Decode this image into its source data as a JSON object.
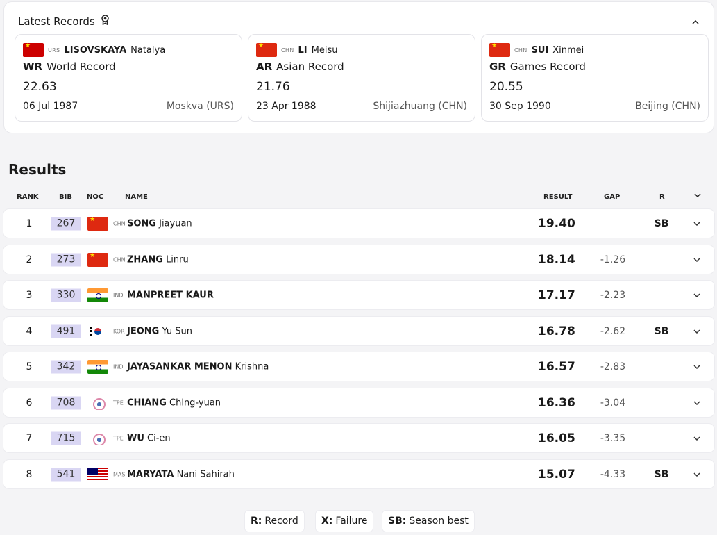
{
  "records_section": {
    "title": "Latest Records"
  },
  "records": [
    {
      "noc": "URS",
      "surname": "LISOVSKAYA",
      "given": "Natalya",
      "code": "WR",
      "label": "World Record",
      "value": "22.63",
      "date": "06 Jul 1987",
      "place": "Moskva (URS)",
      "flag": "urs"
    },
    {
      "noc": "CHN",
      "surname": "LI",
      "given": "Meisu",
      "code": "AR",
      "label": "Asian Record",
      "value": "21.76",
      "date": "23 Apr 1988",
      "place": "Shijiazhuang (CHN)",
      "flag": "chn"
    },
    {
      "noc": "CHN",
      "surname": "SUI",
      "given": "Xinmei",
      "code": "GR",
      "label": "Games Record",
      "value": "20.55",
      "date": "30 Sep 1990",
      "place": "Beijing (CHN)",
      "flag": "chn"
    }
  ],
  "results_section": {
    "title": "Results"
  },
  "columns": {
    "rank": "RANK",
    "bib": "BIB",
    "noc": "NOC",
    "name": "NAME",
    "result": "RESULT",
    "gap": "GAP",
    "r": "R"
  },
  "results": [
    {
      "rank": "1",
      "bib": "267",
      "noc": "CHN",
      "surname": "SONG",
      "given": "Jiayuan",
      "result": "19.40",
      "gap": "",
      "r": "SB",
      "flag": "chn"
    },
    {
      "rank": "2",
      "bib": "273",
      "noc": "CHN",
      "surname": "ZHANG",
      "given": "Linru",
      "result": "18.14",
      "gap": "-1.26",
      "r": "",
      "flag": "chn"
    },
    {
      "rank": "3",
      "bib": "330",
      "noc": "IND",
      "surname": "MANPREET KAUR",
      "given": "",
      "result": "17.17",
      "gap": "-2.23",
      "r": "",
      "flag": "ind"
    },
    {
      "rank": "4",
      "bib": "491",
      "noc": "KOR",
      "surname": "JEONG",
      "given": "Yu Sun",
      "result": "16.78",
      "gap": "-2.62",
      "r": "SB",
      "flag": "kor"
    },
    {
      "rank": "5",
      "bib": "342",
      "noc": "IND",
      "surname": "JAYASANKAR MENON",
      "given": "Krishna",
      "result": "16.57",
      "gap": "-2.83",
      "r": "",
      "flag": "ind"
    },
    {
      "rank": "6",
      "bib": "708",
      "noc": "TPE",
      "surname": "CHIANG",
      "given": "Ching-yuan",
      "result": "16.36",
      "gap": "-3.04",
      "r": "",
      "flag": "tpe"
    },
    {
      "rank": "7",
      "bib": "715",
      "noc": "TPE",
      "surname": "WU",
      "given": "Ci-en",
      "result": "16.05",
      "gap": "-3.35",
      "r": "",
      "flag": "tpe"
    },
    {
      "rank": "8",
      "bib": "541",
      "noc": "MAS",
      "surname": "MARYATA",
      "given": "Nani Sahirah",
      "result": "15.07",
      "gap": "-4.33",
      "r": "SB",
      "flag": "mas"
    }
  ],
  "legend": [
    {
      "code": "R:",
      "label": "Record"
    },
    {
      "code": "X:",
      "label": "Failure"
    },
    {
      "code": "SB:",
      "label": "Season best"
    }
  ],
  "icons": {
    "records": "medal-icon",
    "collapse": "chevron-up-icon",
    "expand": "chevron-down-icon"
  }
}
